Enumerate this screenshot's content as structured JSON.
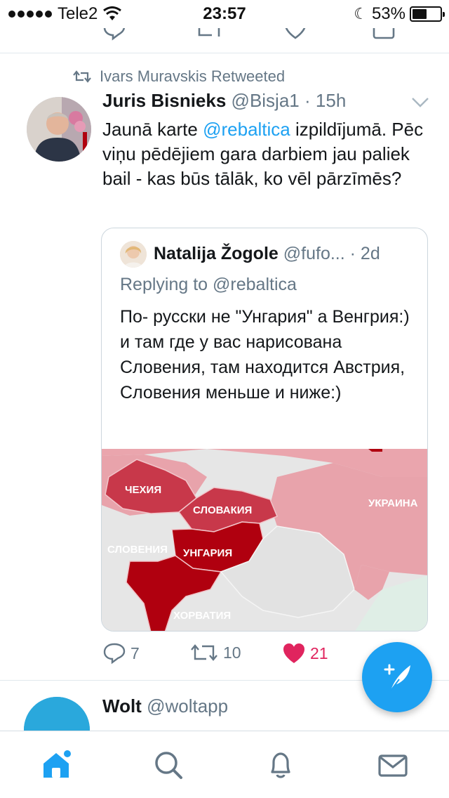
{
  "status_bar": {
    "carrier": "Tele2",
    "time": "23:57",
    "battery_percent": "53%",
    "battery_level": 0.53
  },
  "tweet": {
    "retweeted_by": "Ivars Muravskis Retweeted",
    "author_name": "Juris Bisnieks",
    "author_handle": "@Bisja1",
    "separator": "·",
    "time": "15h",
    "text_before": "Jaunā karte ",
    "text_mention": "@rebaltica",
    "text_after": "  izpildījumā. Pēc viņu pēdējiem gara darbiem jau paliek bail - kas būs tālāk, ko vēl pārzīmēs?",
    "quote": {
      "author_name": "Natalija Žogole",
      "author_handle": "@fufo...",
      "separator": "·",
      "time": "2d",
      "replying_prefix": "Replying to ",
      "replying_to": "@rebaltica",
      "text": "По- русски не \"Унгария\" а Венгрия:) и там где у вас нарисована Словения, там находится Австрия, Словения меньше и ниже:)",
      "map_labels": {
        "czech": "ЧЕХИЯ",
        "slovakia": "СЛОВАКИЯ",
        "ukraine": "УКРАИНА",
        "slovenia": "СЛОВЕНИЯ",
        "hungary": "УНГАРИЯ",
        "croatia": "ХОРВАТИЯ"
      }
    },
    "actions": {
      "replies": "7",
      "retweets": "10",
      "likes": "21"
    }
  },
  "next_tweet": {
    "author_name": "Wolt",
    "author_handle": "@woltapp"
  },
  "colors": {
    "accent": "#1da1f2",
    "like": "#e0245e",
    "secondary_text": "#657786",
    "map_dark_red": "#b0000f",
    "map_red": "#c8384a",
    "map_pink": "#e8a3ab"
  },
  "tabs": [
    "home-icon",
    "search-icon",
    "notifications-icon",
    "messages-icon"
  ]
}
